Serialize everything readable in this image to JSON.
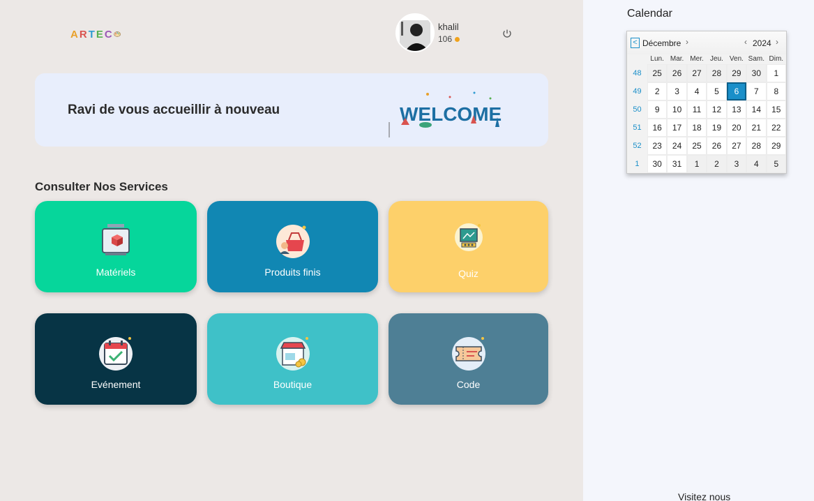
{
  "header": {
    "logo_text": "ARTEC",
    "user_name": "khalil",
    "user_points": "106"
  },
  "welcome": {
    "message": "Ravi de vous accueillir à nouveau",
    "art_text": "WELCOME"
  },
  "services": {
    "title": "Consulter Nos Services",
    "cards": [
      {
        "label": "Matériels",
        "color": "#06d69b",
        "icon": "3d-printer-icon"
      },
      {
        "label": "Produits finis",
        "color": "#1187b3",
        "icon": "shopping-basket-icon"
      },
      {
        "label": "Quiz",
        "color": "#fdd06a",
        "icon": "quiz-board-icon"
      },
      {
        "label": "Evénement",
        "color": "#073445",
        "icon": "calendar-check-icon"
      },
      {
        "label": "Boutique",
        "color": "#3fc1c8",
        "icon": "shop-icon"
      },
      {
        "label": "Code",
        "color": "#4e7f95",
        "icon": "ticket-icon"
      }
    ]
  },
  "sidebar": {
    "calendar_title": "Calendar",
    "visit_label": "Visitez nous"
  },
  "calendar": {
    "month": "Décembre",
    "year": "2024",
    "weekdays": [
      "Lun.",
      "Mar.",
      "Mer.",
      "Jeu.",
      "Ven.",
      "Sam.",
      "Dim."
    ],
    "weeks": [
      {
        "num": "48",
        "days": [
          "25",
          "26",
          "27",
          "28",
          "29",
          "30",
          "1"
        ]
      },
      {
        "num": "49",
        "days": [
          "2",
          "3",
          "4",
          "5",
          "6",
          "7",
          "8"
        ]
      },
      {
        "num": "50",
        "days": [
          "9",
          "10",
          "11",
          "12",
          "13",
          "14",
          "15"
        ]
      },
      {
        "num": "51",
        "days": [
          "16",
          "17",
          "18",
          "19",
          "20",
          "21",
          "22"
        ]
      },
      {
        "num": "52",
        "days": [
          "23",
          "24",
          "25",
          "26",
          "27",
          "28",
          "29"
        ]
      },
      {
        "num": "1",
        "days": [
          "30",
          "31",
          "1",
          "2",
          "3",
          "4",
          "5"
        ]
      }
    ],
    "selected_day": "6",
    "accent": "#1a8fc9"
  }
}
